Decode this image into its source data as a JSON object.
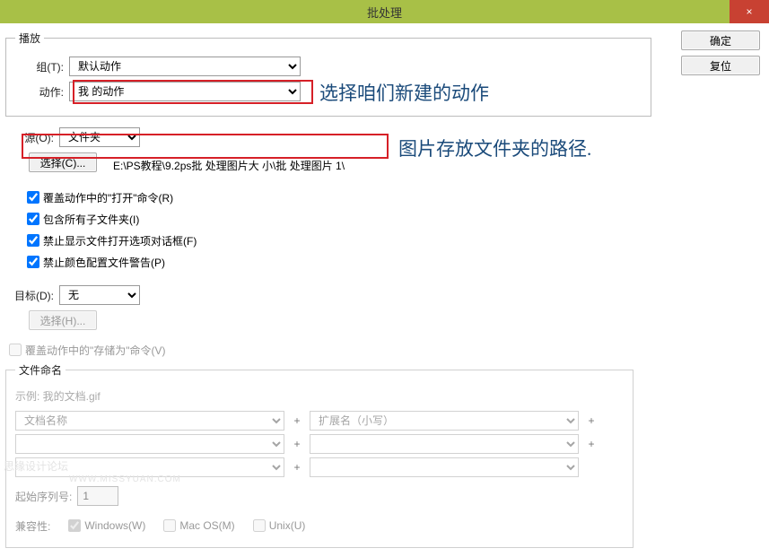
{
  "window": {
    "title": "批处理"
  },
  "buttons": {
    "ok": "确定",
    "reset": "复位",
    "close": "×"
  },
  "play": {
    "legend": "播放",
    "set_label": "组(T):",
    "set_value": "默认动作",
    "action_label": "动作:",
    "action_value": "我 的动作"
  },
  "annot1": "选择咱们新建的动作",
  "source": {
    "label": "源(O):",
    "value": "文件夹",
    "choose_btn": "选择(C)...",
    "path": "E:\\PS教程\\9.2ps批 处理图片大 小\\批 处理图片  1\\",
    "chk_override_open": "覆盖动作中的\"打开\"命令(R)",
    "chk_include_sub": "包含所有子文件夹(I)",
    "chk_suppress_open": "禁止显示文件打开选项对话框(F)",
    "chk_suppress_color": "禁止颜色配置文件警告(P)"
  },
  "annot2": "图片存放文件夹的路径.",
  "dest": {
    "label": "目标(D):",
    "value": "无",
    "choose_btn": "选择(H)...",
    "chk_override_save": "覆盖动作中的\"存储为\"命令(V)",
    "fn_legend": "文件命名",
    "example": "示例: 我的文档.gif",
    "fn1": "文档名称",
    "fn2": "扩展名（小写）",
    "seq_label": "起始序列号:",
    "seq_value": "1",
    "compat_label": "兼容性:",
    "compat_win": "Windows(W)",
    "compat_mac": "Mac OS(M)",
    "compat_unix": "Unix(U)"
  },
  "watermark": {
    "line1": "思缘设计论坛",
    "line2": "WWW.MISSYUAN.COM"
  }
}
